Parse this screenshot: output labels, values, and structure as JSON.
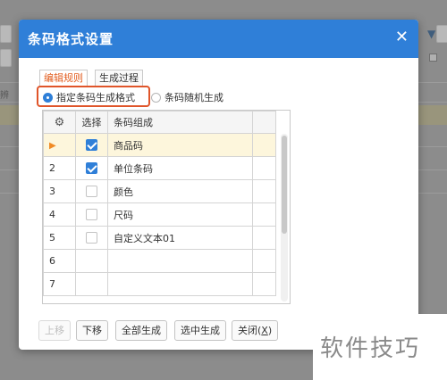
{
  "background": {
    "left_label": "辨",
    "filter_icon": "funnel-icon"
  },
  "dialog": {
    "title": "条码格式设置",
    "close_icon": "close-icon",
    "tabs": [
      {
        "label": "编辑规则",
        "active": true
      },
      {
        "label": "生成过程",
        "active": false
      }
    ],
    "mode_options": [
      {
        "label": "指定条码生成格式",
        "selected": true
      },
      {
        "label": "条码随机生成",
        "selected": false
      }
    ],
    "grid": {
      "header_icon": "gear-icon",
      "columns": [
        "选择",
        "条码组成"
      ],
      "rows": [
        {
          "num": "",
          "current": true,
          "checked": true,
          "name": "商品码"
        },
        {
          "num": "2",
          "current": false,
          "checked": true,
          "name": "单位条码"
        },
        {
          "num": "3",
          "current": false,
          "checked": false,
          "name": "颜色"
        },
        {
          "num": "4",
          "current": false,
          "checked": false,
          "name": "尺码"
        },
        {
          "num": "5",
          "current": false,
          "checked": false,
          "name": "自定义文本01"
        },
        {
          "num": "6",
          "current": false,
          "checked": null,
          "name": ""
        },
        {
          "num": "7",
          "current": false,
          "checked": null,
          "name": ""
        }
      ]
    },
    "buttons": {
      "move_up": "上移",
      "move_down": "下移",
      "generate_all": "全部生成",
      "generate_selected": "选中生成",
      "close_prefix": "关闭(",
      "close_hotkey": "X",
      "close_suffix": ")"
    }
  },
  "watermark": "软件技巧",
  "colors": {
    "title_bar": "#2f7fd8",
    "accent_orange": "#e25d1f",
    "highlight_border": "#e0552a",
    "current_row": "#fdf6dc",
    "checkbox": "#2f7fd8"
  }
}
